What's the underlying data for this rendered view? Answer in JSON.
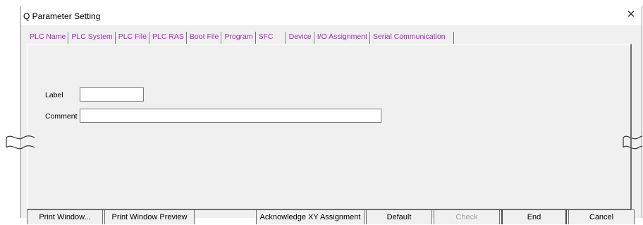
{
  "window": {
    "title": "Q Parameter Setting",
    "close_glyph": "✕"
  },
  "tabs": [
    {
      "label": "PLC Name",
      "active": true
    },
    {
      "label": "PLC System"
    },
    {
      "label": "PLC File"
    },
    {
      "label": "PLC RAS"
    },
    {
      "label": "Boot File"
    },
    {
      "label": "Program"
    },
    {
      "label": "SFC"
    },
    {
      "label": "Device"
    },
    {
      "label": "I/O Assignment"
    },
    {
      "label": "Serial Communication"
    }
  ],
  "form": {
    "label_text": "Label",
    "label_value": "",
    "comment_text": "Comment",
    "comment_value": ""
  },
  "buttons": {
    "print_window": "Print Window...",
    "print_preview": "Print Window Preview",
    "acknowledge": "Acknowledge XY Assignment",
    "default": "Default",
    "check": "Check",
    "end": "End",
    "cancel": "Cancel"
  },
  "colors": {
    "tab_text": "#9b2fae",
    "dialog_bg": "#f0f0f0"
  },
  "icons": {
    "close": "close-icon",
    "break_marks": "wave-break-icon"
  }
}
